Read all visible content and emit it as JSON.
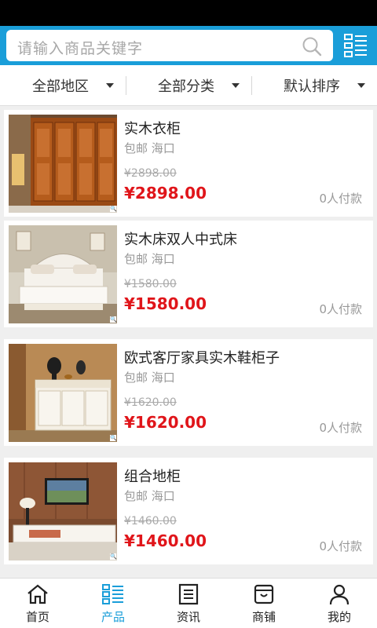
{
  "search": {
    "placeholder": "请输入商品关键字"
  },
  "filters": [
    {
      "label": "全部地区"
    },
    {
      "label": "全部分类"
    },
    {
      "label": "默认排序"
    }
  ],
  "products": [
    {
      "title": "实木衣柜",
      "meta": "包邮 海口",
      "old_price": "¥2898.00",
      "price": "¥2898.00",
      "sold": "0人付款"
    },
    {
      "title": "实木床双人中式床",
      "meta": "包邮 海口",
      "old_price": "¥1580.00",
      "price": "¥1580.00",
      "sold": "0人付款"
    },
    {
      "title": "欧式客厅家具实木鞋柜子",
      "meta": "包邮 海口",
      "old_price": "¥1620.00",
      "price": "¥1620.00",
      "sold": "0人付款"
    },
    {
      "title": "组合地柜",
      "meta": "包邮 海口",
      "old_price": "¥1460.00",
      "price": "¥1460.00",
      "sold": "0人付款"
    }
  ],
  "tabs": [
    {
      "label": "首页",
      "icon": "home-icon"
    },
    {
      "label": "产品",
      "icon": "product-list-icon"
    },
    {
      "label": "资讯",
      "icon": "news-icon"
    },
    {
      "label": "商铺",
      "icon": "shop-icon"
    },
    {
      "label": "我的",
      "icon": "user-icon"
    }
  ],
  "colors": {
    "accent": "#1a9ed9",
    "price": "#e0151a"
  }
}
